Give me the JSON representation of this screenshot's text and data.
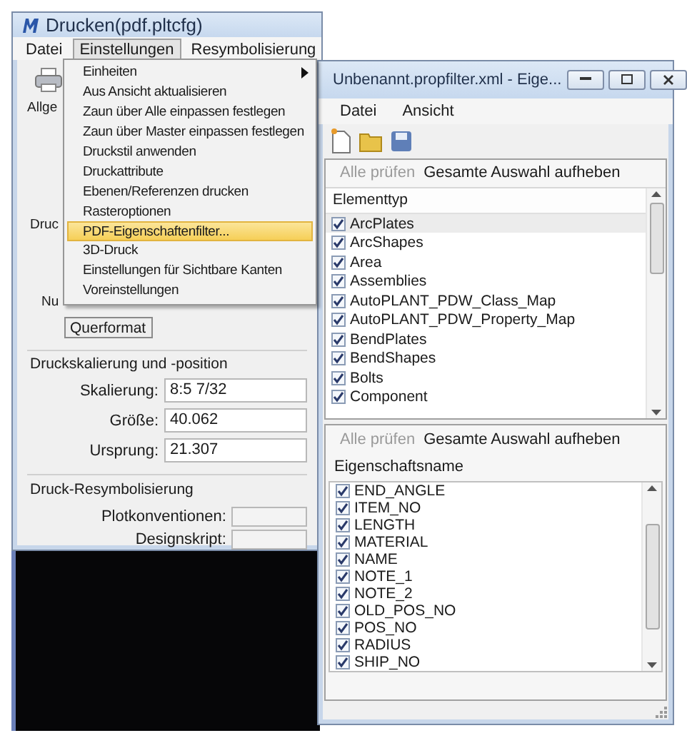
{
  "main_window": {
    "title": "Drucken(pdf.pltcfg)",
    "menu": [
      {
        "label": "Datei",
        "open": false
      },
      {
        "label": "Einstellungen",
        "open": true
      },
      {
        "label": "Resymbolisierung",
        "open": false
      }
    ],
    "partial_labels": [
      "Allge",
      "Druc",
      "Nu"
    ],
    "orientation": "Querformat",
    "scaling_group": {
      "title": "Druckskalierung und -position",
      "fields": [
        {
          "label": "Skalierung:",
          "value": "8:5 7/32"
        },
        {
          "label": "Größe:",
          "value": "40.062"
        },
        {
          "label": "Ursprung:",
          "value": "21.307"
        }
      ]
    },
    "resym_group": {
      "title": "Druck-Resymbolisierung",
      "fields": [
        {
          "label": "Plotkonventionen:"
        },
        {
          "label": "Designskript:"
        }
      ]
    }
  },
  "dropdown_menu": [
    {
      "label": "Einheiten",
      "submenu": true,
      "selected": false
    },
    {
      "label": "Aus Ansicht aktualisieren",
      "submenu": false,
      "selected": false
    },
    {
      "label": "Zaun über Alle einpassen festlegen",
      "submenu": false,
      "selected": false
    },
    {
      "label": "Zaun über Master einpassen festlegen",
      "submenu": false,
      "selected": false
    },
    {
      "label": "Druckstil anwenden",
      "submenu": false,
      "selected": false
    },
    {
      "label": "Druckattribute",
      "submenu": false,
      "selected": false
    },
    {
      "label": "Ebenen/Referenzen drucken",
      "submenu": false,
      "selected": false
    },
    {
      "label": "Rasteroptionen",
      "submenu": false,
      "selected": false
    },
    {
      "label": "PDF-Eigenschaftenfilter...",
      "submenu": false,
      "selected": true
    },
    {
      "label": "3D-Druck",
      "submenu": false,
      "selected": false
    },
    {
      "label": "Einstellungen für Sichtbare Kanten",
      "submenu": false,
      "selected": false
    },
    {
      "label": "Voreinstellungen",
      "submenu": false,
      "selected": false
    }
  ],
  "filter_window": {
    "title": "Unbenannt.propfilter.xml - Eige...",
    "menu": [
      "Datei",
      "Ansicht"
    ],
    "element_panel": {
      "actions": [
        {
          "label": "Alle prüfen",
          "disabled": true
        },
        {
          "label": "Gesamte Auswahl aufheben",
          "disabled": false
        }
      ],
      "header": "Elementtyp",
      "rows": [
        {
          "label": "ArcPlates",
          "checked": true,
          "selected": true
        },
        {
          "label": "ArcShapes",
          "checked": true,
          "selected": false
        },
        {
          "label": "Area",
          "checked": true,
          "selected": false
        },
        {
          "label": "Assemblies",
          "checked": true,
          "selected": false
        },
        {
          "label": "AutoPLANT_PDW_Class_Map",
          "checked": true,
          "selected": false
        },
        {
          "label": "AutoPLANT_PDW_Property_Map",
          "checked": true,
          "selected": false
        },
        {
          "label": "BendPlates",
          "checked": true,
          "selected": false
        },
        {
          "label": "BendShapes",
          "checked": true,
          "selected": false
        },
        {
          "label": "Bolts",
          "checked": true,
          "selected": false
        },
        {
          "label": "Component",
          "checked": true,
          "selected": false
        }
      ]
    },
    "property_panel": {
      "actions": [
        {
          "label": "Alle prüfen",
          "disabled": true
        },
        {
          "label": "Gesamte Auswahl aufheben",
          "disabled": false
        }
      ],
      "header": "Eigenschaftsname",
      "rows": [
        {
          "label": "END_ANGLE",
          "checked": true
        },
        {
          "label": "ITEM_NO",
          "checked": true
        },
        {
          "label": "LENGTH",
          "checked": true
        },
        {
          "label": "MATERIAL",
          "checked": true
        },
        {
          "label": "NAME",
          "checked": true
        },
        {
          "label": "NOTE_1",
          "checked": true
        },
        {
          "label": "NOTE_2",
          "checked": true
        },
        {
          "label": "OLD_POS_NO",
          "checked": true
        },
        {
          "label": "POS_NO",
          "checked": true
        },
        {
          "label": "RADIUS",
          "checked": true
        },
        {
          "label": "SHIP_NO",
          "checked": true
        }
      ]
    }
  }
}
